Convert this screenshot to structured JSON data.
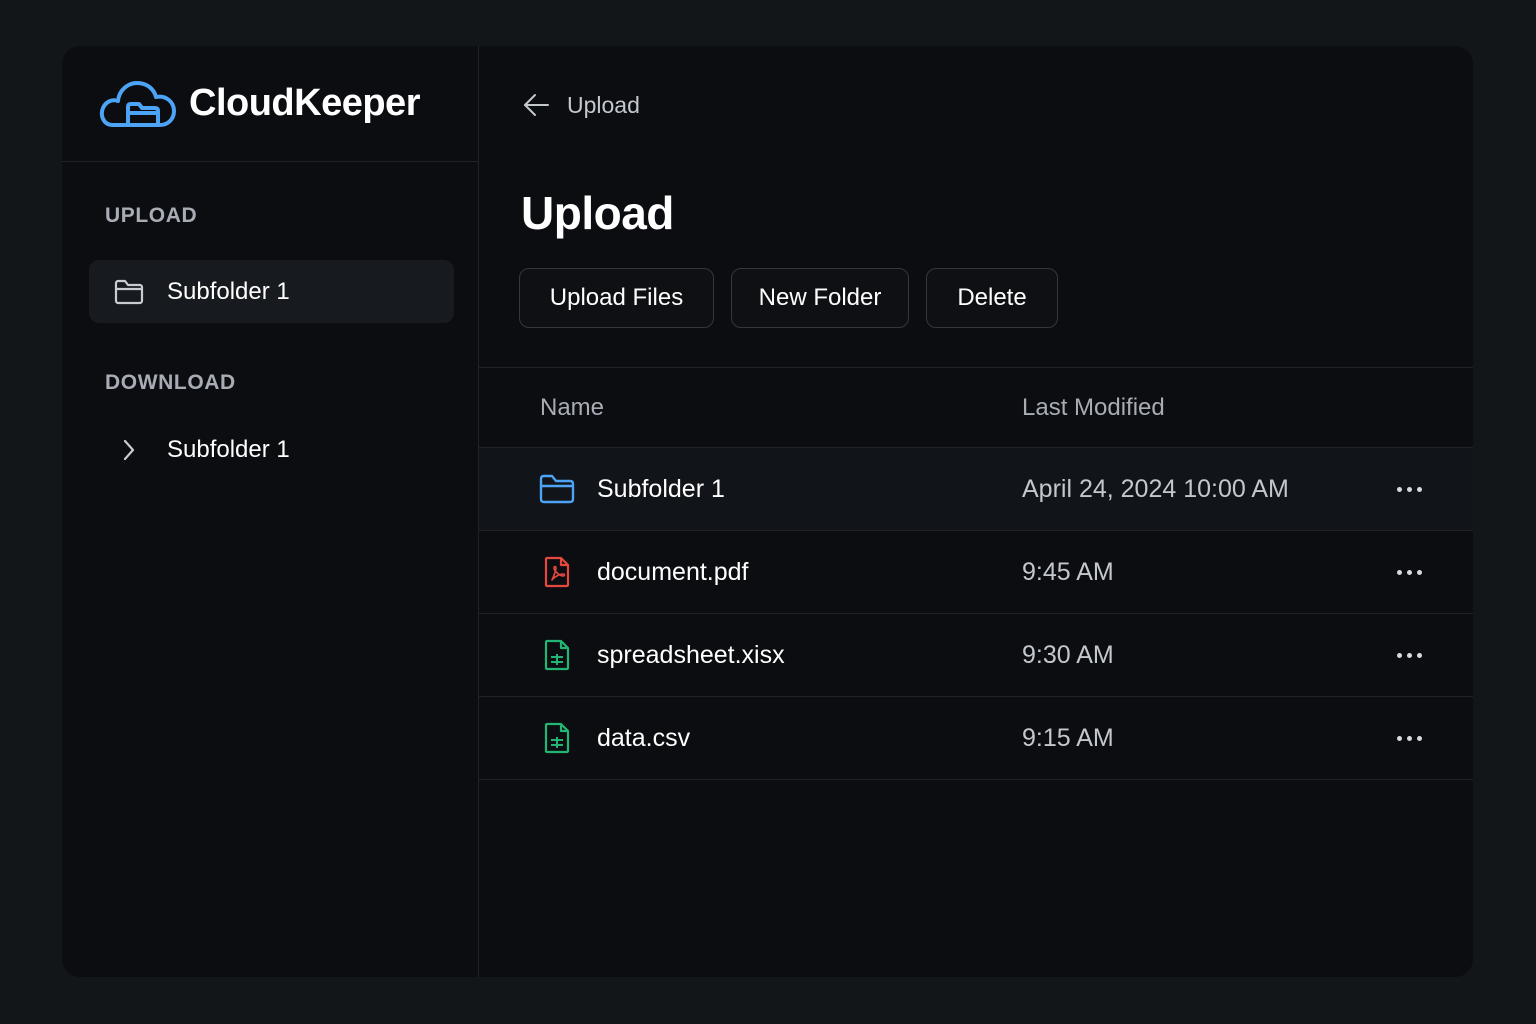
{
  "app": {
    "name": "CloudKeeper",
    "accent_color": "#4da3f5"
  },
  "sidebar": {
    "sections": [
      {
        "heading": "UPLOAD",
        "items": [
          {
            "label": "Subfolder 1",
            "icon": "folder-icon",
            "active": true
          }
        ]
      },
      {
        "heading": "DOWNLOAD",
        "items": [
          {
            "label": "Subfolder 1",
            "icon": "chevron-right-icon",
            "active": false
          }
        ]
      }
    ]
  },
  "breadcrumb": {
    "back_icon": "arrow-left-icon",
    "current": "Upload"
  },
  "page": {
    "title": "Upload"
  },
  "toolbar": {
    "upload_label": "Upload Files",
    "new_folder_label": "New Folder",
    "delete_label": "Delete"
  },
  "table": {
    "columns": [
      "Name",
      "Last Modified"
    ],
    "rows": [
      {
        "name": "Subfolder 1",
        "modified": "April 24, 2024 10:00 AM",
        "type": "folder",
        "icon": "folder-icon",
        "icon_color": "#4da3f5"
      },
      {
        "name": "document.pdf",
        "modified": "9:45 AM",
        "type": "pdf",
        "icon": "pdf-file-icon",
        "icon_color": "#e5483d"
      },
      {
        "name": "spreadsheet.xisx",
        "modified": "9:30 AM",
        "type": "spreadsheet",
        "icon": "spreadsheet-file-icon",
        "icon_color": "#22b573"
      },
      {
        "name": "data.csv",
        "modified": "9:15 AM",
        "type": "csv",
        "icon": "csv-file-icon",
        "icon_color": "#22b573"
      }
    ]
  }
}
